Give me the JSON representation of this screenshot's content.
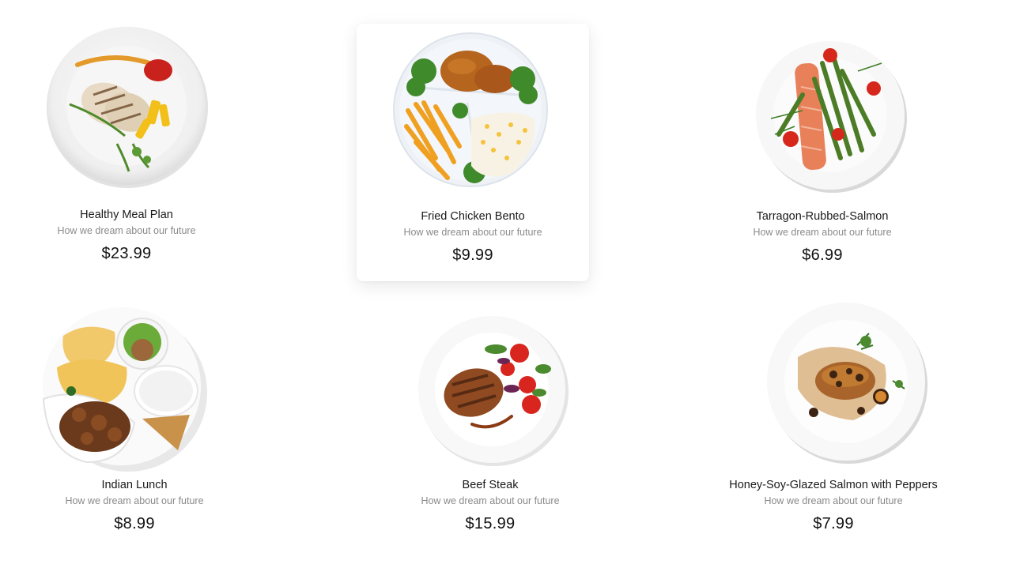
{
  "products": [
    {
      "id": "healthy-meal-plan",
      "title": "Healthy Meal Plan",
      "subtitle": "How we dream about our future",
      "price": "$23.99",
      "image_icon": "grilled-chicken-plate-icon",
      "selected": false
    },
    {
      "id": "fried-chicken-bento",
      "title": "Fried Chicken Bento",
      "subtitle": "How we dream about our future",
      "price": "$9.99",
      "image_icon": "fried-chicken-bento-plate-icon",
      "selected": true
    },
    {
      "id": "tarragon-rubbed-salmon",
      "title": "Tarragon-Rubbed-Salmon",
      "subtitle": "How we dream about our future",
      "price": "$6.99",
      "image_icon": "salmon-asparagus-plate-icon",
      "selected": false
    },
    {
      "id": "indian-lunch",
      "title": "Indian Lunch",
      "subtitle": "How we dream about our future",
      "price": "$8.99",
      "image_icon": "indian-thali-plate-icon",
      "selected": false
    },
    {
      "id": "beef-steak",
      "title": "Beef Steak",
      "subtitle": "How we dream about our future",
      "price": "$15.99",
      "image_icon": "steak-salad-plate-icon",
      "selected": false
    },
    {
      "id": "honey-soy-glazed-salmon",
      "title": "Honey-Soy-Glazed Salmon with Peppers",
      "subtitle": "How we dream about our future",
      "price": "$7.99",
      "image_icon": "glazed-salmon-plate-icon",
      "selected": false
    }
  ],
  "colors": {
    "text": "#1a1a1a",
    "subtitle": "#8a8a8a",
    "card_background": "#ffffff",
    "plate": "#f4f4f4"
  }
}
